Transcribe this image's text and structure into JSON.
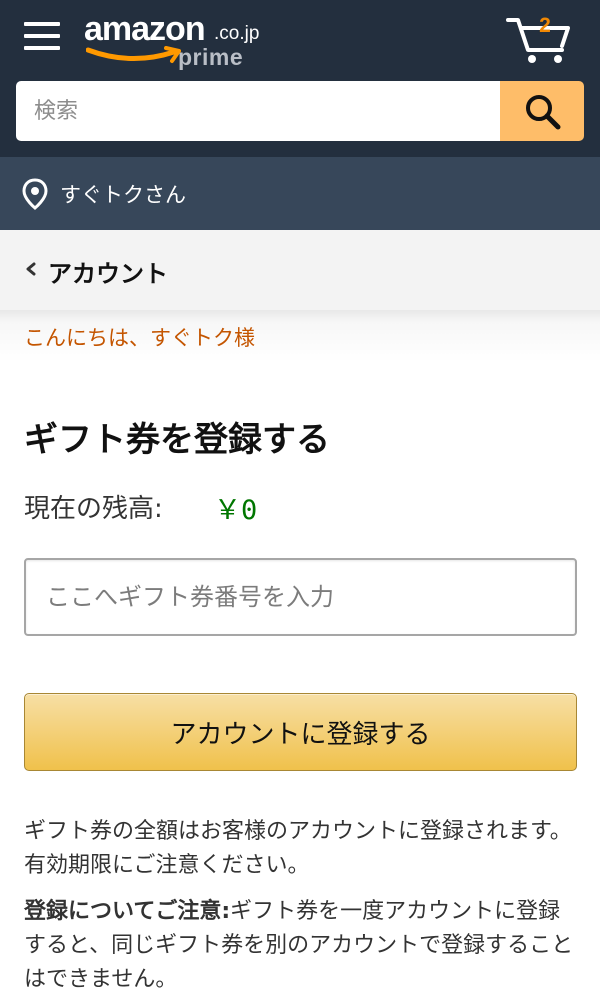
{
  "header": {
    "logo": {
      "brand": "amazon",
      "tld": ".co.jp",
      "tier": "prime"
    },
    "cart_count": "2",
    "icons": {
      "menu": "hamburger-menu-icon",
      "cart": "cart-icon",
      "search": "search-icon",
      "location": "location-pin-icon",
      "back": "chevron-left-icon"
    }
  },
  "search": {
    "placeholder": "検索",
    "value": ""
  },
  "location": {
    "label": "すぐトクさん"
  },
  "nav": {
    "back_label": "アカウント"
  },
  "greeting": "こんにちは、すぐトク様",
  "main": {
    "title": "ギフト券を登録する",
    "balance_label": "現在の残高:",
    "balance_value": "￥0",
    "code_placeholder": "ここへギフト券番号を入力",
    "code_value": "",
    "redeem_button": "アカウントに登録する",
    "note_1": "ギフト券の全額はお客様のアカウントに登録されます。有効期限にご注意ください。",
    "note_2_bold": "登録についてご注意:",
    "note_2_text": "ギフト券を一度アカウントに登録すると、同じギフト券を別のアカウントで登録することはできません。"
  },
  "colors": {
    "header_bg": "#232f3e",
    "location_bg": "#37475a",
    "search_button": "#febd69",
    "greeting_text": "#c45500",
    "balance_text": "#007600",
    "button_gradient_top": "#f7dfa5",
    "button_gradient_bottom": "#f0c14b",
    "cart_count": "#f08804"
  }
}
